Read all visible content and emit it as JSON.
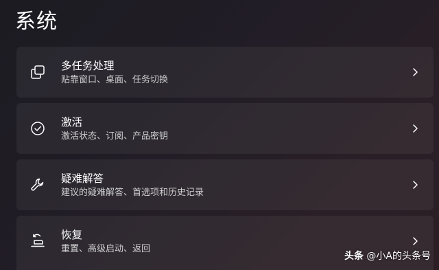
{
  "page": {
    "title": "系统"
  },
  "cards": [
    {
      "icon": "multitasking-icon",
      "title": "多任务处理",
      "description": "贴靠窗口、桌面、任务切换"
    },
    {
      "icon": "activation-check-icon",
      "title": "激活",
      "description": "激活状态、订阅、产品密钥"
    },
    {
      "icon": "wrench-icon",
      "title": "疑难解答",
      "description": "建议的疑难解答、首选项和历史记录"
    },
    {
      "icon": "recovery-icon",
      "title": "恢复",
      "description": "重置、高级启动、返回"
    }
  ],
  "watermark": {
    "brand": "头条",
    "handle": "@小A的头条号"
  },
  "colors": {
    "background": "#201c24",
    "card": "#2b2830",
    "text_primary": "#ffffff",
    "text_secondary": "#cfcfcf"
  }
}
